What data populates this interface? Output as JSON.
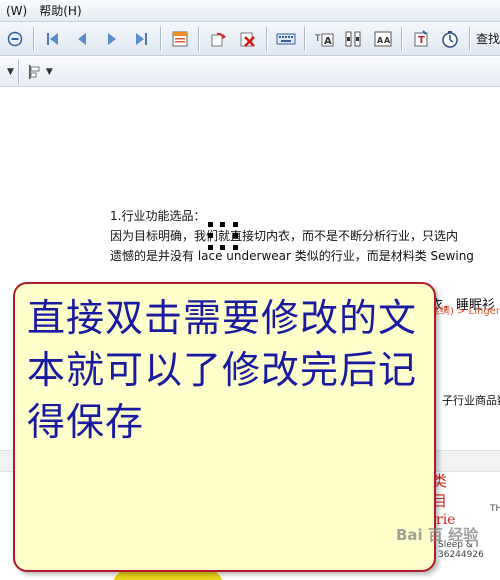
{
  "menubar": {
    "items": [
      "(W)",
      "帮助(H)"
    ]
  },
  "toolbar": {
    "search_label": "查找",
    "icons": [
      "nav-back-icon",
      "first-page-icon",
      "prev-page-icon",
      "next-page-icon",
      "last-page-icon",
      "form-icon",
      "rotate-icon",
      "delete-icon",
      "keyboard-icon",
      "text-size-icon",
      "columns-icon",
      "align-icon",
      "text-edit-icon",
      "timer-icon"
    ]
  },
  "document": {
    "line1": "1.行业功能选品：",
    "line2": "因为目标明确，我们就直接切内衣，而不是不断分析行业，只选内",
    "line3": "遗憾的是并没有 lace underwear 类似的行业，而是材料类 Sewing",
    "web_line": "衣，睡眠衫",
    "web_small": "丝绸) > Lingerie,",
    "web_right": "子行业商品数",
    "red_chars": [
      "类",
      "目",
      "rie"
    ],
    "small_texts": [
      "Sleep & I",
      "36244926",
      "TH"
    ]
  },
  "callout": {
    "text": "直接双击需要修改的文本就可以了修改完后记得保存"
  },
  "watermark": "Bai 百 经验"
}
